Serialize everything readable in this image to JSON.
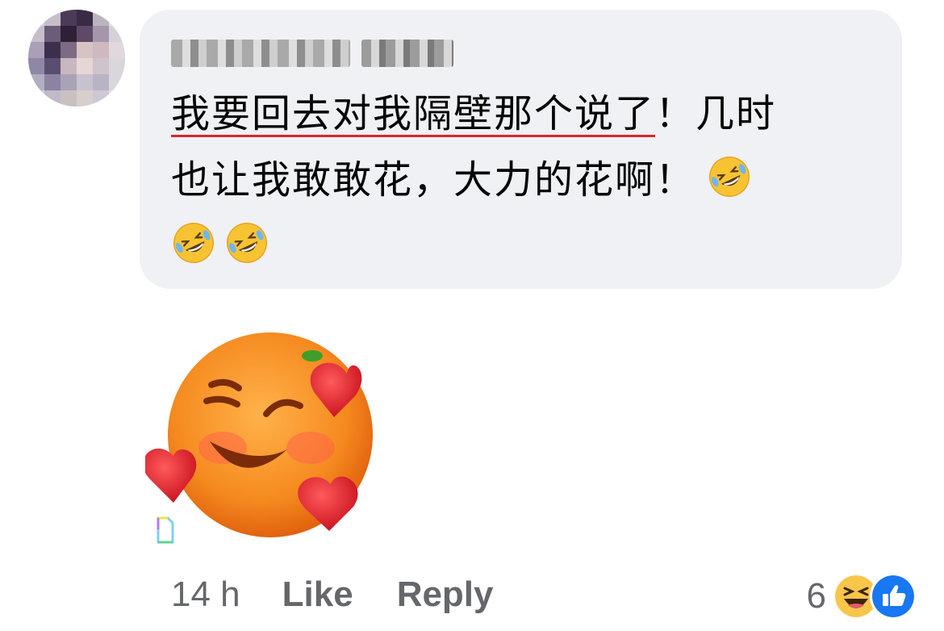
{
  "comment": {
    "author_name_redacted": true,
    "text_underlined": "我要回去对我隔壁那个说了",
    "text_rest": "！几时\n也让我敢敢花，大力的花啊！"
  },
  "emojis": {
    "inline": [
      "rolling-on-floor-laughing",
      "rolling-on-floor-laughing",
      "rolling-on-floor-laughing"
    ],
    "sticker": "smiling-orange-with-hearts"
  },
  "actions": {
    "time": "14 h",
    "like_label": "Like",
    "reply_label": "Reply"
  },
  "reactions": {
    "count": "6",
    "types": [
      "haha",
      "like"
    ]
  },
  "colors": {
    "bubble_bg": "#f0f1f4",
    "meta_text": "#65676b",
    "underline_red": "#e0242c",
    "like_blue": "#1877f2",
    "haha_yellow": "#f7c64a"
  }
}
